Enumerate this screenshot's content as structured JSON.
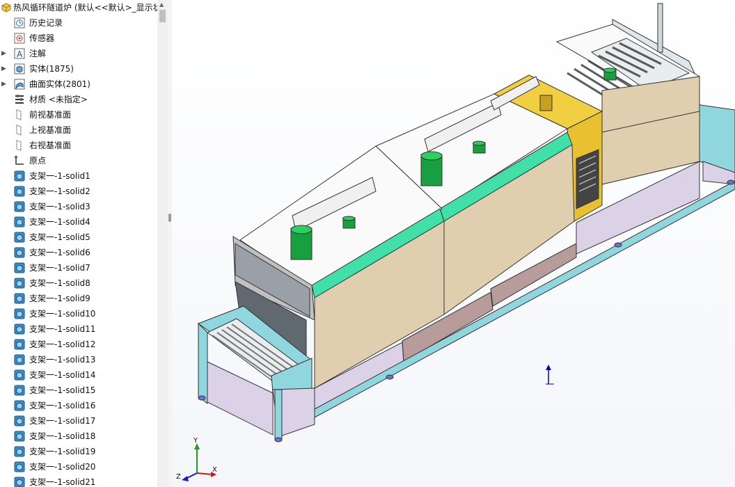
{
  "tree": {
    "root_label": "热风循环隧道炉  (默认<<默认>_显示状",
    "items": [
      {
        "label": "历史记录",
        "icon": "history-icon",
        "arrow": false
      },
      {
        "label": "传感器",
        "icon": "sensor-icon",
        "arrow": false
      },
      {
        "label": "注解",
        "icon": "annotation-icon",
        "arrow": true
      },
      {
        "label": "实体(1875)",
        "icon": "solid-bodies-icon",
        "arrow": true
      },
      {
        "label": "曲面实体(2801)",
        "icon": "surface-bodies-icon",
        "arrow": true
      },
      {
        "label": "材质 <未指定>",
        "icon": "material-icon",
        "arrow": false
      },
      {
        "label": "前视基准面",
        "icon": "plane-icon",
        "arrow": false
      },
      {
        "label": "上视基准面",
        "icon": "plane-icon",
        "arrow": false
      },
      {
        "label": "右视基准面",
        "icon": "plane-icon",
        "arrow": false
      },
      {
        "label": "原点",
        "icon": "origin-icon",
        "arrow": false
      }
    ],
    "solids": [
      "支架一-1-solid1",
      "支架一-1-solid2",
      "支架一-1-solid3",
      "支架一-1-solid4",
      "支架一-1-solid5",
      "支架一-1-solid6",
      "支架一-1-solid7",
      "支架一-1-solid8",
      "支架一-1-solid9",
      "支架一-1-solid10",
      "支架一-1-solid11",
      "支架一-1-solid12",
      "支架一-1-solid13",
      "支架一-1-solid14",
      "支架一-1-solid15",
      "支架一-1-solid16",
      "支架一-1-solid17",
      "支架一-1-solid18",
      "支架一-1-solid19",
      "支架一-1-solid20",
      "支架一-1-solid21"
    ]
  },
  "triad": {
    "x": "X",
    "y": "Y",
    "z": "Z"
  },
  "colors": {
    "frame": "#8fd6de",
    "panel_purple": "#dcd2e8",
    "panel_mauve": "#b89c9c",
    "body_tan": "#e0cfae",
    "stripe_green": "#40e0a8",
    "top_white": "#fafafa",
    "yellow_section": "#f0d040",
    "motor_green": "#18a040"
  }
}
